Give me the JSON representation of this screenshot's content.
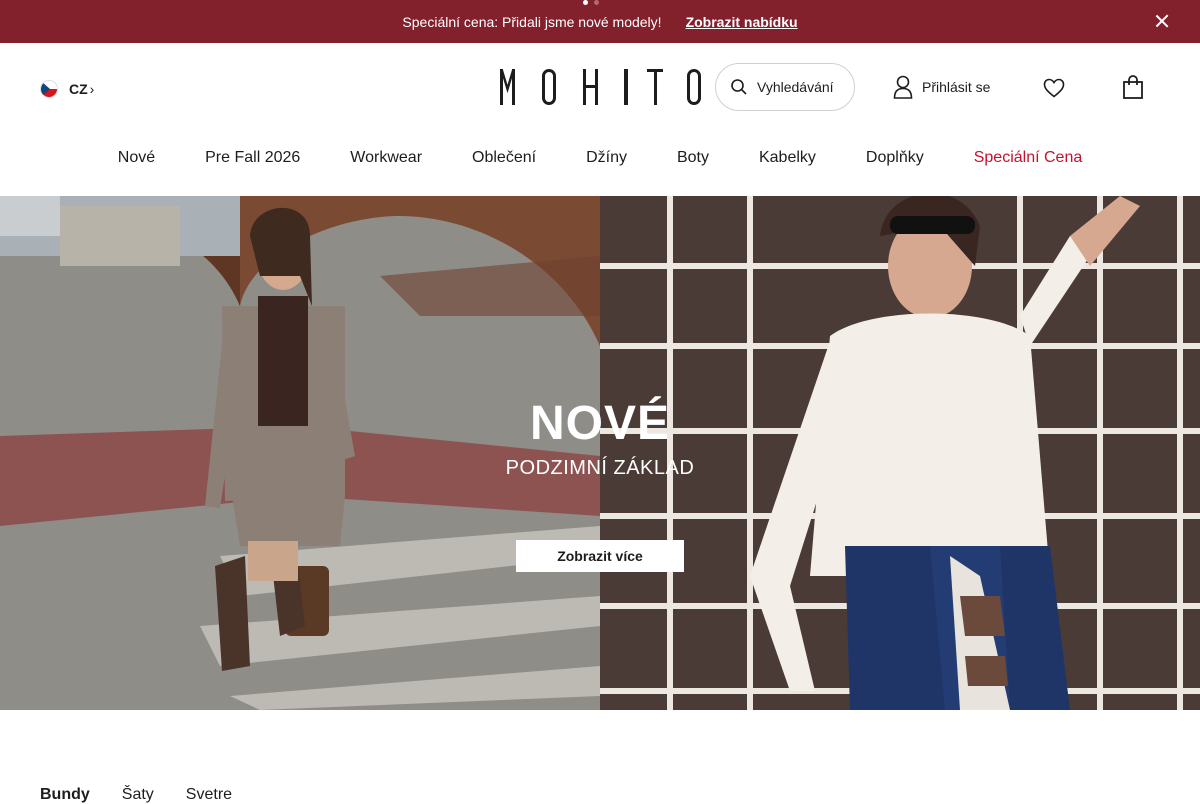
{
  "promo": {
    "message": "Speciální cena: Přidali jsme nové modely!",
    "link_label": "Zobrazit nabídku"
  },
  "header": {
    "language_code": "CZ",
    "logo_text": "MOHITO",
    "search_placeholder": "Vyhledávání",
    "login_label": "Přihlásit se"
  },
  "nav": {
    "items": [
      "Nové",
      "Pre Fall 2026",
      "Workwear",
      "Oblečení",
      "Džíny",
      "Boty",
      "Kabelky",
      "Doplňky",
      "Speciální Cena"
    ]
  },
  "hero": {
    "title": "NOVÉ",
    "subtitle": "PODZIMNÍ ZÁKLAD",
    "cta_label": "Zobrazit více"
  },
  "categories": {
    "tabs": [
      "Bundy",
      "Šaty",
      "Svetre"
    ]
  },
  "colors": {
    "promo_bg": "#82202c",
    "special_link": "#c8102e",
    "text": "#1d1d1b"
  }
}
